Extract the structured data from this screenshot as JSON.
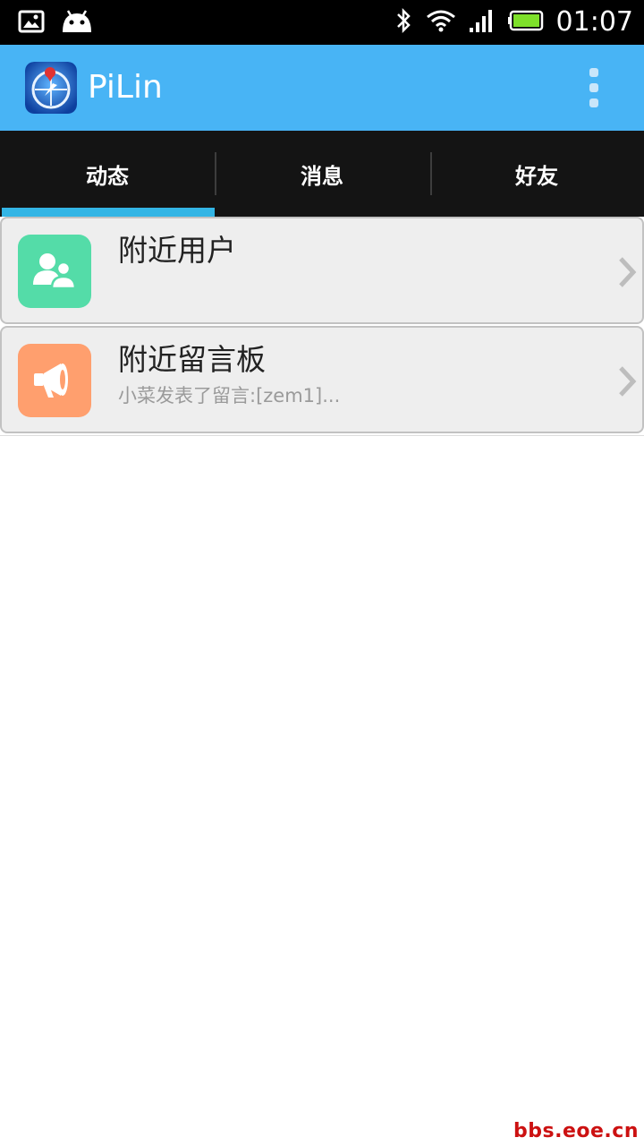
{
  "status_bar": {
    "time": "01:07",
    "left_icons": [
      "gallery-icon",
      "android-icon"
    ],
    "right_icons": [
      "bluetooth-icon",
      "wifi-icon",
      "signal-icon",
      "battery-icon"
    ]
  },
  "action_bar": {
    "title": "PiLin",
    "icon": "compass-app-icon",
    "overflow_icon": "overflow-menu-icon",
    "background": "#48b4f5"
  },
  "tabs": [
    {
      "label": "动态",
      "selected": true
    },
    {
      "label": "消息",
      "selected": false
    },
    {
      "label": "好友",
      "selected": false
    }
  ],
  "tab_indicator_color": "#33b5e5",
  "list": [
    {
      "title": "附近用户",
      "subtitle": "",
      "icon": "users-icon",
      "icon_color": "#54dca8"
    },
    {
      "title": "附近留言板",
      "subtitle": "小菜发表了留言:[zem1]...",
      "icon": "megaphone-icon",
      "icon_color": "#ff9f6e"
    }
  ],
  "watermark": "bbs.eoe.cn"
}
